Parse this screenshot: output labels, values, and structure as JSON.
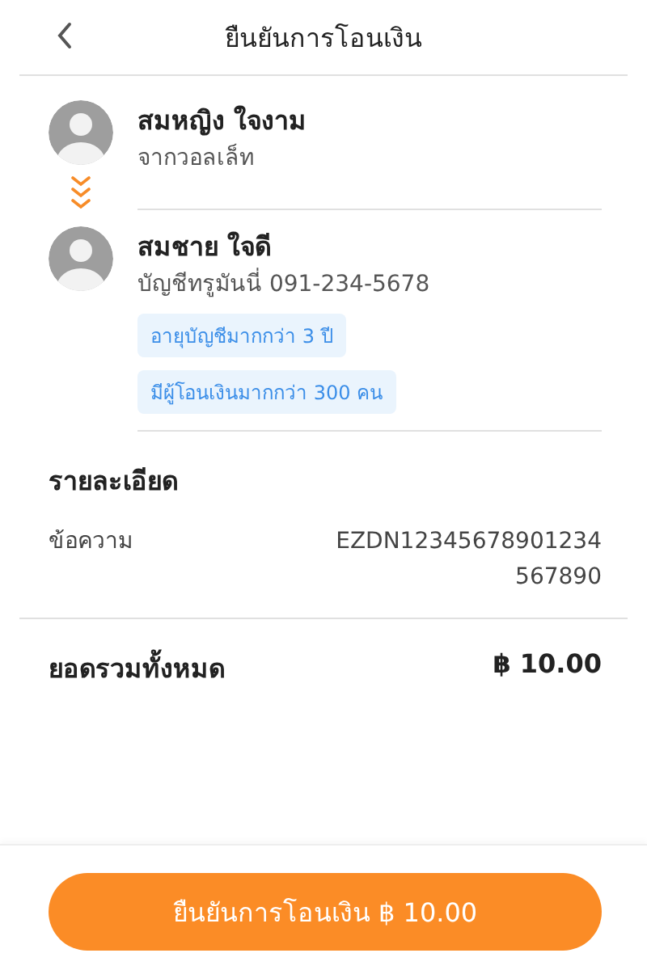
{
  "header": {
    "title": "ยืนยันการโอนเงิน"
  },
  "sender": {
    "name": "สมหญิง ใจงาม",
    "subtitle": "จากวอลเล็ท"
  },
  "receiver": {
    "name": "สมชาย ใจดี",
    "subtitle": "บัญชีทรูมันนี่ 091-234-5678",
    "tags": [
      "อายุบัญชีมากกว่า 3 ปี",
      "มีผู้โอนเงินมากกว่า 300 คน"
    ]
  },
  "details": {
    "title": "รายละเอียด",
    "rows": [
      {
        "label": "ข้อความ",
        "value": "EZDN12345678901234567890"
      }
    ]
  },
  "total": {
    "label": "ยอดรวมทั้งหมด",
    "amount": "฿ 10.00"
  },
  "confirm_button": "ยืนยันการโอนเงิน ฿ 10.00"
}
